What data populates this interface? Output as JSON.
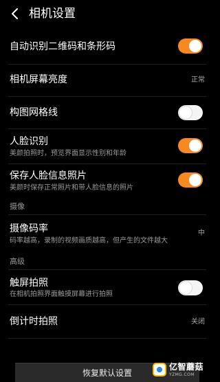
{
  "header": {
    "title": "相机设置"
  },
  "settings": {
    "qr_scan": {
      "label": "自动识别二维码和条形码",
      "enabled": true
    },
    "brightness": {
      "label": "相机屏幕亮度",
      "value": "正常"
    },
    "grid": {
      "label": "构图网格线",
      "enabled": false
    },
    "face_detect": {
      "label": "人脸识别",
      "desc": "美颜拍照时，预览界面显示性别和年龄",
      "enabled": true
    },
    "save_face": {
      "label": "保存人脸信息照片",
      "desc": "美颜时保存正常照片和带人脸信息的照片",
      "enabled": true
    }
  },
  "video_section": {
    "title": "摄像",
    "bitrate": {
      "label": "摄像码率",
      "desc": "码率越高，录制的视频画质越高，但产生的文件越大",
      "value": "中"
    }
  },
  "advanced_section": {
    "title": "高级",
    "touch_shoot": {
      "label": "触屏拍照",
      "desc": "在相机拍照界面触摸屏幕进行拍照",
      "enabled": false
    },
    "timer": {
      "label": "倒计时拍照",
      "value": "关闭"
    }
  },
  "footer": {
    "reset_label": "恢复默认设置"
  },
  "watermark": {
    "name": "亿智蘑菇",
    "url": "YZMG.COM"
  },
  "colors": {
    "accent": "#f6891f",
    "background": "#000000"
  }
}
